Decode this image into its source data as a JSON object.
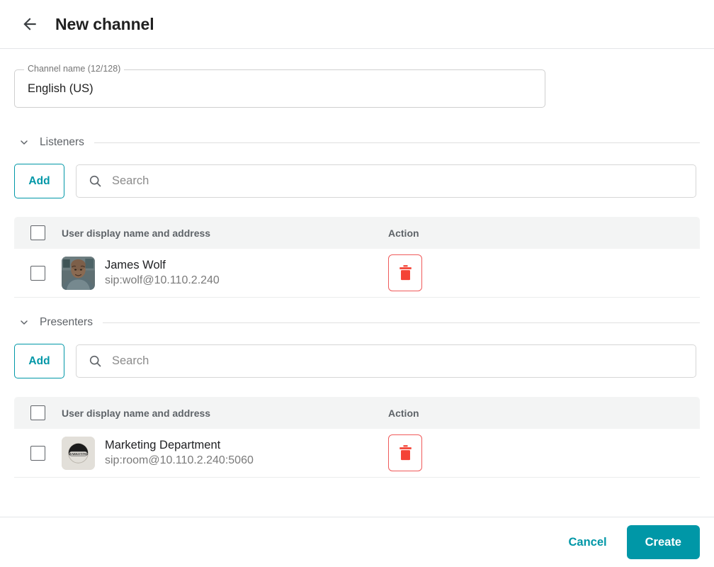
{
  "header": {
    "back_icon": "arrow-left-icon",
    "title": "New channel"
  },
  "channel_name_field": {
    "legend": "Channel name (12/128)",
    "value": "English (US)",
    "placeholder": "Channel name"
  },
  "sections": [
    {
      "id": "listeners",
      "title": "Listeners",
      "chevron_icon": "chevron-down-icon",
      "add_label": "Add",
      "search_placeholder": "Search",
      "search_value": "",
      "search_icon": "search-icon",
      "columns": {
        "user": "User display name and address",
        "action": "Action"
      },
      "rows": [
        {
          "name": "James Wolf",
          "address": "sip:wolf@10.110.2.240",
          "avatar_type": "photo",
          "delete_icon": "trash-icon",
          "selected": false
        }
      ]
    },
    {
      "id": "presenters",
      "title": "Presenters",
      "chevron_icon": "chevron-down-icon",
      "add_label": "Add",
      "search_placeholder": "Search",
      "search_value": "",
      "search_icon": "search-icon",
      "columns": {
        "user": "User display name and address",
        "action": "Action"
      },
      "rows": [
        {
          "name": "Marketing Department",
          "address": "sip:room@10.110.2.240:5060",
          "avatar_type": "room",
          "avatar_text": "MARKETING",
          "delete_icon": "trash-icon",
          "selected": false
        }
      ]
    }
  ],
  "footer": {
    "cancel_label": "Cancel",
    "create_label": "Create"
  },
  "colors": {
    "accent": "#0097a7",
    "danger": "#f05a5a",
    "header_bg": "#f3f4f4",
    "text": "#202124",
    "muted": "#7a7a7a"
  }
}
